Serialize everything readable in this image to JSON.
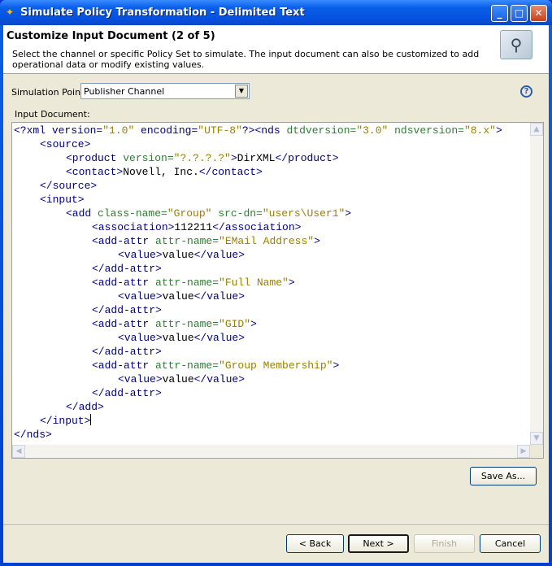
{
  "window": {
    "title": "Simulate Policy Transformation - Delimited Text",
    "icon": "novell-designer-icon"
  },
  "header": {
    "title": "Customize Input Document (2 of 5)",
    "description": "Select the channel or specific Policy Set to simulate. The input document can also be customized to add operational data or modify existing values.",
    "icon": "wizard-compass-icon"
  },
  "simulation_point": {
    "label": "Simulation Point:",
    "value": "Publisher Channel"
  },
  "input_document": {
    "label": "Input Document:"
  },
  "colors": {
    "tag": "#000080",
    "attr": "#2e7d32",
    "value": "#9a8000",
    "text": "#000000"
  },
  "code_lines": [
    {
      "indent": 0,
      "tokens": [
        [
          "tag",
          "<?xml "
        ],
        [
          "tag",
          "version="
        ],
        [
          "val",
          "\"1.0\""
        ],
        [
          "tag",
          " encoding="
        ],
        [
          "val",
          "\"UTF-8\""
        ],
        [
          "tag",
          "?><nds "
        ],
        [
          "attr",
          "dtdversion="
        ],
        [
          "val",
          "\"3.0\""
        ],
        [
          "attr",
          " ndsversion="
        ],
        [
          "val",
          "\"8.x\""
        ],
        [
          "tag",
          ">"
        ]
      ]
    },
    {
      "indent": 1,
      "tokens": [
        [
          "tag",
          "<source>"
        ]
      ]
    },
    {
      "indent": 2,
      "tokens": [
        [
          "tag",
          "<product "
        ],
        [
          "attr",
          "version="
        ],
        [
          "val",
          "\"?.?.?.?\""
        ],
        [
          "tag",
          ">"
        ],
        [
          "text",
          "DirXML"
        ],
        [
          "tag",
          "</product>"
        ]
      ]
    },
    {
      "indent": 2,
      "tokens": [
        [
          "tag",
          "<contact>"
        ],
        [
          "text",
          "Novell, Inc."
        ],
        [
          "tag",
          "</contact>"
        ]
      ]
    },
    {
      "indent": 1,
      "tokens": [
        [
          "tag",
          "</source>"
        ]
      ]
    },
    {
      "indent": 1,
      "tokens": [
        [
          "tag",
          "<input>"
        ]
      ]
    },
    {
      "indent": 2,
      "tokens": [
        [
          "tag",
          "<add "
        ],
        [
          "attr",
          "class-name="
        ],
        [
          "val",
          "\"Group\""
        ],
        [
          "attr",
          " src-dn="
        ],
        [
          "val",
          "\"users\\User1\""
        ],
        [
          "tag",
          ">"
        ]
      ]
    },
    {
      "indent": 3,
      "tokens": [
        [
          "tag",
          "<association>"
        ],
        [
          "text",
          "112211"
        ],
        [
          "tag",
          "</association>"
        ]
      ]
    },
    {
      "indent": 3,
      "tokens": [
        [
          "tag",
          "<add-attr "
        ],
        [
          "attr",
          "attr-name="
        ],
        [
          "val",
          "\"EMail Address\""
        ],
        [
          "tag",
          ">"
        ]
      ]
    },
    {
      "indent": 4,
      "tokens": [
        [
          "tag",
          "<value>"
        ],
        [
          "text",
          "value"
        ],
        [
          "tag",
          "</value>"
        ]
      ]
    },
    {
      "indent": 3,
      "tokens": [
        [
          "tag",
          "</add-attr>"
        ]
      ]
    },
    {
      "indent": 3,
      "tokens": [
        [
          "tag",
          "<add-attr "
        ],
        [
          "attr",
          "attr-name="
        ],
        [
          "val",
          "\"Full Name\""
        ],
        [
          "tag",
          ">"
        ]
      ]
    },
    {
      "indent": 4,
      "tokens": [
        [
          "tag",
          "<value>"
        ],
        [
          "text",
          "value"
        ],
        [
          "tag",
          "</value>"
        ]
      ]
    },
    {
      "indent": 3,
      "tokens": [
        [
          "tag",
          "</add-attr>"
        ]
      ]
    },
    {
      "indent": 3,
      "tokens": [
        [
          "tag",
          "<add-attr "
        ],
        [
          "attr",
          "attr-name="
        ],
        [
          "val",
          "\"GID\""
        ],
        [
          "tag",
          ">"
        ]
      ]
    },
    {
      "indent": 4,
      "tokens": [
        [
          "tag",
          "<value>"
        ],
        [
          "text",
          "value"
        ],
        [
          "tag",
          "</value>"
        ]
      ]
    },
    {
      "indent": 3,
      "tokens": [
        [
          "tag",
          "</add-attr>"
        ]
      ]
    },
    {
      "indent": 3,
      "tokens": [
        [
          "tag",
          "<add-attr "
        ],
        [
          "attr",
          "attr-name="
        ],
        [
          "val",
          "\"Group Membership\""
        ],
        [
          "tag",
          ">"
        ]
      ]
    },
    {
      "indent": 4,
      "tokens": [
        [
          "tag",
          "<value>"
        ],
        [
          "text",
          "value"
        ],
        [
          "tag",
          "</value>"
        ]
      ]
    },
    {
      "indent": 3,
      "tokens": [
        [
          "tag",
          "</add-attr>"
        ]
      ]
    },
    {
      "indent": 2,
      "tokens": [
        [
          "tag",
          "</add>"
        ]
      ]
    },
    {
      "indent": 1,
      "tokens": [
        [
          "tag",
          "</input>"
        ]
      ],
      "cursor": true
    },
    {
      "indent": 0,
      "tokens": [
        [
          "tag",
          "</nds>"
        ]
      ]
    }
  ],
  "buttons": {
    "save_as": "Save As...",
    "back": "< Back",
    "next": "Next >",
    "finish": "Finish",
    "cancel": "Cancel"
  }
}
